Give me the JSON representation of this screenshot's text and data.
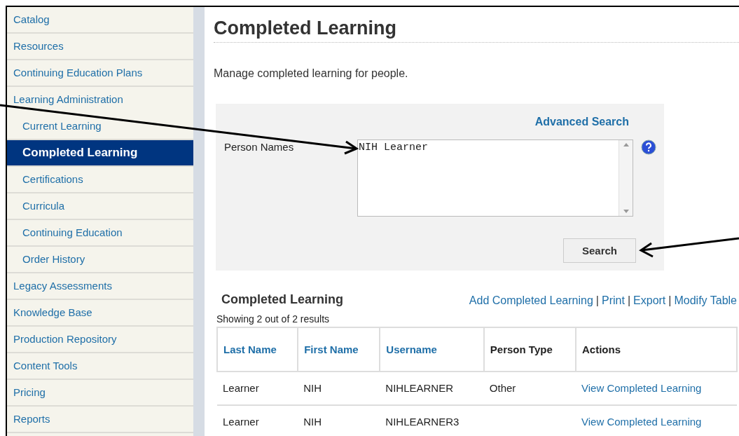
{
  "sidebar": {
    "items": [
      {
        "label": "Catalog",
        "selected": false
      },
      {
        "label": "Resources",
        "selected": false
      },
      {
        "label": "Continuing Education Plans",
        "selected": false
      },
      {
        "label": "Learning Administration",
        "selected": false,
        "children": [
          {
            "label": "Current Learning",
            "selected": false
          },
          {
            "label": "Completed Learning",
            "selected": true
          },
          {
            "label": "Certifications",
            "selected": false
          },
          {
            "label": "Curricula",
            "selected": false
          },
          {
            "label": "Continuing Education",
            "selected": false
          },
          {
            "label": "Order History",
            "selected": false
          }
        ]
      },
      {
        "label": "Legacy Assessments",
        "selected": false
      },
      {
        "label": "Knowledge Base",
        "selected": false
      },
      {
        "label": "Production Repository",
        "selected": false
      },
      {
        "label": "Content Tools",
        "selected": false
      },
      {
        "label": "Pricing",
        "selected": false
      },
      {
        "label": "Reports",
        "selected": false
      }
    ]
  },
  "page": {
    "title": "Completed Learning",
    "description": "Manage completed learning for people."
  },
  "search_panel": {
    "advanced_link": "Advanced Search",
    "field_label": "Person Names",
    "field_value": "NIH Learner",
    "search_button": "Search"
  },
  "results": {
    "title": "Completed Learning",
    "actions": [
      "Add Completed Learning",
      "Print",
      "Export",
      "Modify Table"
    ],
    "action_separator": "|",
    "summary": "Showing 2 out of 2 results",
    "columns": [
      {
        "label": "Last Name",
        "sortable": true
      },
      {
        "label": "First Name",
        "sortable": true
      },
      {
        "label": "Username",
        "sortable": true
      },
      {
        "label": "Person Type",
        "sortable": false
      },
      {
        "label": "Actions",
        "sortable": false
      }
    ],
    "rows": [
      {
        "last_name": "Learner",
        "first_name": "NIH",
        "username": "NIHLEARNER",
        "person_type": "Other",
        "action": "View Completed Learning"
      },
      {
        "last_name": "Learner",
        "first_name": "NIH",
        "username": "NIHLEARNER3",
        "action": "View Completed Learning"
      }
    ]
  }
}
